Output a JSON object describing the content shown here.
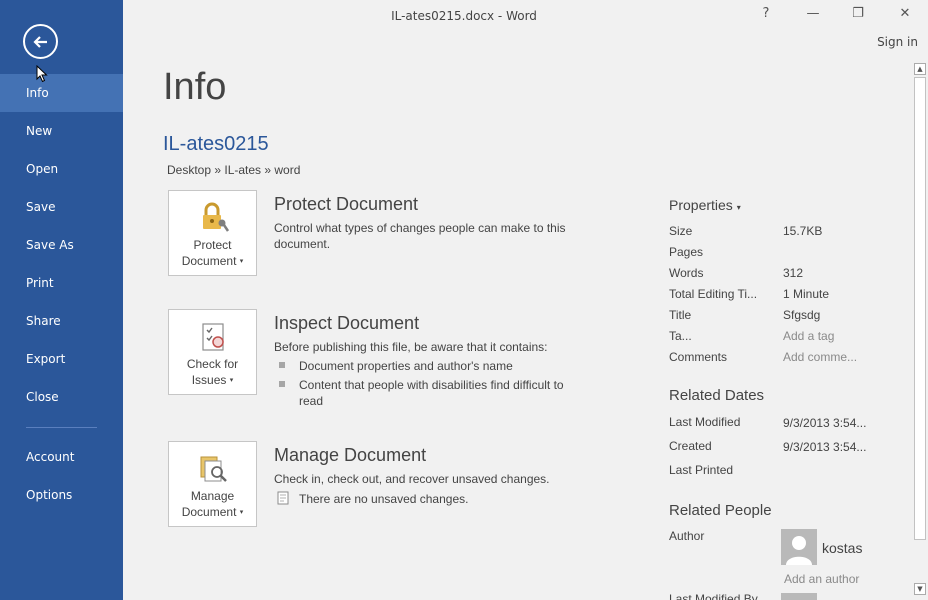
{
  "window": {
    "title": "IL-ates0215.docx - Word",
    "help_label": "?",
    "minimize_label": "—",
    "restore_label": "❐",
    "close_label": "✕",
    "sign_in": "Sign in"
  },
  "sidebar": {
    "items": [
      {
        "label": "Info",
        "active": true
      },
      {
        "label": "New"
      },
      {
        "label": "Open"
      },
      {
        "label": "Save"
      },
      {
        "label": "Save As"
      },
      {
        "label": "Print"
      },
      {
        "label": "Share"
      },
      {
        "label": "Export"
      },
      {
        "label": "Close"
      },
      {
        "label": "Account"
      },
      {
        "label": "Options"
      }
    ],
    "accent": "#2b579a"
  },
  "main": {
    "page_title": "Info",
    "doc_name": "IL-ates0215",
    "doc_path": "Desktop » IL-ates » word"
  },
  "sections": {
    "protect": {
      "btn_line1": "Protect",
      "btn_line2": "Document",
      "title": "Protect Document",
      "desc": "Control what types of changes people can make to this document.",
      "icon": "lock-key-icon"
    },
    "inspect": {
      "btn_line1": "Check for",
      "btn_line2": "Issues",
      "title": "Inspect Document",
      "desc": "Before publishing this file, be aware that it contains:",
      "bullets": [
        "Document properties and author's name",
        "Content that people with disabilities find difficult to read"
      ],
      "icon": "inspect-checklist-icon"
    },
    "manage": {
      "btn_line1": "Manage",
      "btn_line2": "Document",
      "title": "Manage Document",
      "desc": "Check in, check out, and recover unsaved changes.",
      "note": "There are no unsaved changes.",
      "icon": "manage-document-icon"
    }
  },
  "properties": {
    "heading": "Properties",
    "rows": [
      {
        "key": "Size",
        "value": "15.7KB"
      },
      {
        "key": "Pages",
        "value": ""
      },
      {
        "key": "Words",
        "value": "312"
      },
      {
        "key": "Total Editing Ti...",
        "value": "1 Minute"
      },
      {
        "key": "Title",
        "value": "Sfgsdg"
      },
      {
        "key": "Ta...",
        "value": "Add a tag"
      },
      {
        "key": "Comments",
        "value": "Add comme..."
      }
    ]
  },
  "related_dates": {
    "heading": "Related Dates",
    "rows": [
      {
        "key": "Last Modified",
        "value": "9/3/2013 3:54..."
      },
      {
        "key": "Created",
        "value": "9/3/2013 3:54..."
      },
      {
        "key": "Last Printed",
        "value": ""
      }
    ]
  },
  "related_people": {
    "heading": "Related People",
    "author_key": "Author",
    "author_name": "kostas",
    "add_author": "Add an author",
    "last_modified_by_key": "Last Modified By"
  }
}
